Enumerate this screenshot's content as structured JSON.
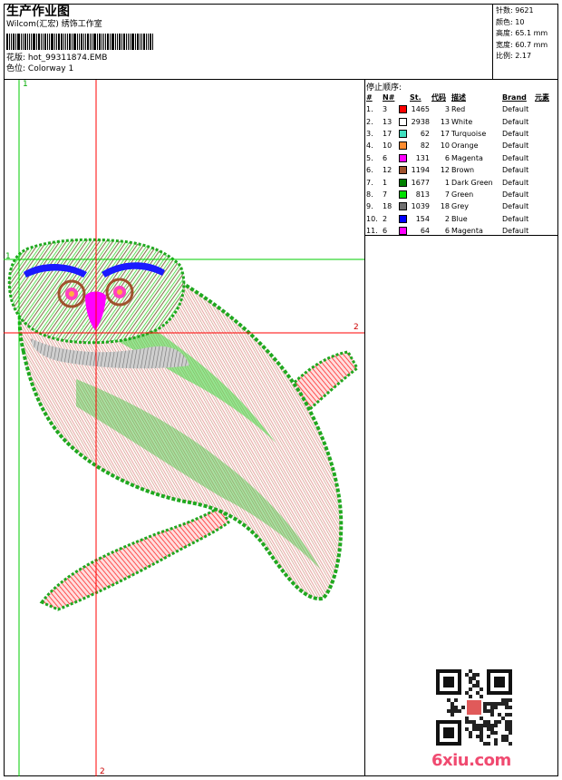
{
  "header": {
    "title": "生产作业图",
    "studio": "Wilcom(汇宏) 绣饰工作室",
    "design_label": "花版:",
    "design_file": "hot_99311874.EMB",
    "colorway_label": "色位:",
    "colorway": "Colorway 1"
  },
  "stats": [
    {
      "label": "针数:",
      "value": "9621"
    },
    {
      "label": "颜色:",
      "value": "10"
    },
    {
      "label": "高度:",
      "value": "65.1 mm"
    },
    {
      "label": "宽度:",
      "value": "60.7 mm"
    },
    {
      "label": "比例:",
      "value": "2.17"
    }
  ],
  "stop_sequence": {
    "title": "停止顺序:",
    "columns": [
      "#",
      "N#",
      "St.",
      "代码",
      "描述",
      "Brand",
      "元素"
    ],
    "rows": [
      {
        "idx": "1.",
        "n": "3",
        "color": "#ff0000",
        "st": "1465",
        "code": "3",
        "desc": "Red",
        "brand": "Default"
      },
      {
        "idx": "2.",
        "n": "13",
        "color": "#ffffff",
        "st": "2938",
        "code": "13",
        "desc": "White",
        "brand": "Default"
      },
      {
        "idx": "3.",
        "n": "17",
        "color": "#40e0c0",
        "st": "62",
        "code": "17",
        "desc": "Turquoise",
        "brand": "Default"
      },
      {
        "idx": "4.",
        "n": "10",
        "color": "#ff8c30",
        "st": "82",
        "code": "10",
        "desc": "Orange",
        "brand": "Default"
      },
      {
        "idx": "5.",
        "n": "6",
        "color": "#ff00ff",
        "st": "131",
        "code": "6",
        "desc": "Magenta",
        "brand": "Default"
      },
      {
        "idx": "6.",
        "n": "12",
        "color": "#a0522d",
        "st": "1194",
        "code": "12",
        "desc": "Brown",
        "brand": "Default"
      },
      {
        "idx": "7.",
        "n": "1",
        "color": "#008000",
        "st": "1677",
        "code": "1",
        "desc": "Dark Green",
        "brand": "Default"
      },
      {
        "idx": "8.",
        "n": "7",
        "color": "#00e000",
        "st": "813",
        "code": "7",
        "desc": "Green",
        "brand": "Default"
      },
      {
        "idx": "9.",
        "n": "18",
        "color": "#707070",
        "st": "1039",
        "code": "18",
        "desc": "Grey",
        "brand": "Default"
      },
      {
        "idx": "10.",
        "n": "2",
        "color": "#0000ff",
        "st": "154",
        "code": "2",
        "desc": "Blue",
        "brand": "Default"
      },
      {
        "idx": "11.",
        "n": "6",
        "color": "#ff00ff",
        "st": "64",
        "code": "6",
        "desc": "Magenta",
        "brand": "Default"
      }
    ]
  },
  "guides": {
    "v1": "1",
    "h1": "1",
    "h2": "2",
    "v2": "2"
  },
  "watermark": "6xiu.com",
  "colors": {
    "guide_green": "#00cc00",
    "guide_red": "#ff0000",
    "watermark": "#f04a70"
  }
}
